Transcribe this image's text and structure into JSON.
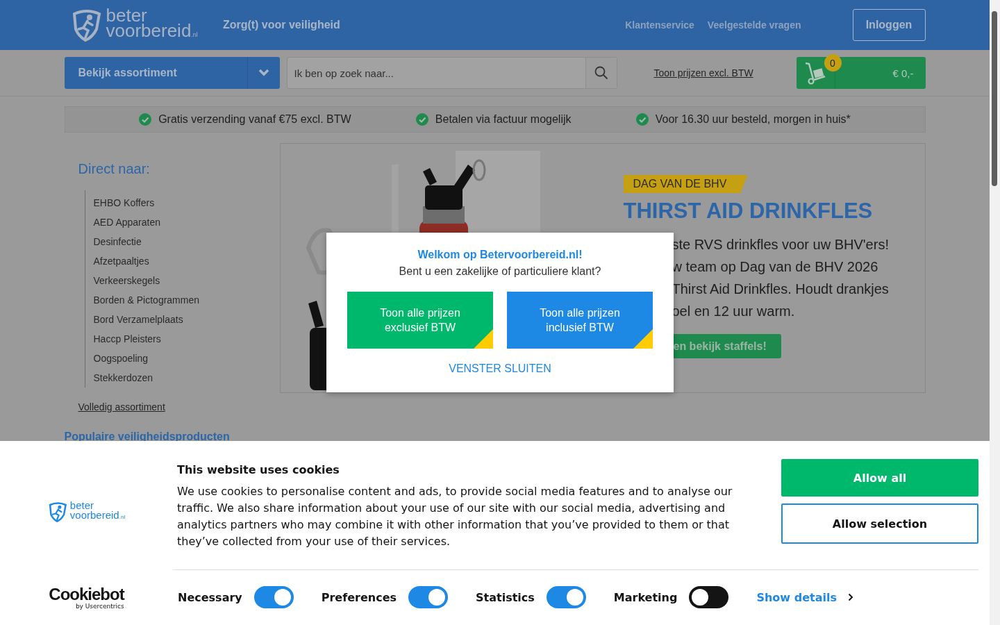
{
  "header": {
    "logo_top": "beter",
    "logo_bottom": "voorbereid",
    "logo_suffix": ".nl",
    "tagline": "Zorg(t) voor veiligheid",
    "links": [
      "Klantenservice",
      "Veelgestelde vragen"
    ],
    "login": "Inloggen"
  },
  "toolbar": {
    "assortment": "Bekijk assortiment",
    "search": {
      "placeholder": "Ik ben op zoek naar..."
    },
    "vat_link": "Toon prijzen excl. BTW",
    "cart": {
      "count": "0",
      "total": "€ 0,-"
    }
  },
  "usps": [
    "Gratis verzending vanaf €75 excl. BTW",
    "Betalen via factuur mogelijk",
    "Voor 16.30 uur besteld, morgen in huis*"
  ],
  "sidebar": {
    "title": "Direct naar:",
    "items": [
      "EHBO Koffers",
      "AED Apparaten",
      "Desinfectie",
      "Afzetpaaltjes",
      "Verkeerskegels",
      "Borden & Pictogrammen",
      "Bord Verzamelplaats",
      "Haccp Pleisters",
      "Oogspoeling",
      "Stekkerdozen"
    ],
    "all_link": "Volledig assortiment",
    "popular": "Populaire veiligheidsproducten"
  },
  "banner": {
    "tag": "DAG VAN DE BHV",
    "title": "THIRST AID DRINKFLES",
    "lines": [
      "ste RVS drinkfles voor uw BHV'ers!",
      "w team op Dag van de BHV 2026",
      "Thirst Aid Drinkfles. Houdt drankjes",
      "oel en 12 uur warm."
    ],
    "button": "en bekijk staffels!"
  },
  "modal": {
    "title": "Welkom op Betervoorbereid.nl!",
    "question": "Bent u een zakelijke of particuliere klant?",
    "options": [
      {
        "label": "Toon alle prijzen exclusief BTW",
        "color": "#00b86b"
      },
      {
        "label": "Toon alle prijzen inclusief BTW",
        "color": "#1e88e5"
      }
    ],
    "close": "VENSTER SLUITEN"
  },
  "cookies": {
    "logo_top": "beter",
    "logo_bottom": "voorbereid",
    "logo_suffix": ".nl",
    "title": "This website uses cookies",
    "text": "We use cookies to personalise content and ads, to provide social media features and to analyse our traffic. We also share information about your use of our site with our social media, advertising and analytics partners who may combine it with other information that you’ve provided to them or that they’ve collected from your use of their services.",
    "buttons": [
      {
        "label": "Allow all",
        "kind": "primary"
      },
      {
        "label": "Allow selection",
        "kind": "outline"
      }
    ],
    "toggles": [
      {
        "label": "Necessary",
        "on": true
      },
      {
        "label": "Preferences",
        "on": true
      },
      {
        "label": "Statistics",
        "on": true
      },
      {
        "label": "Marketing",
        "on": false
      }
    ],
    "details": "Show details",
    "brand": "Cookiebot",
    "brand_sub": "by Usercentrics"
  }
}
